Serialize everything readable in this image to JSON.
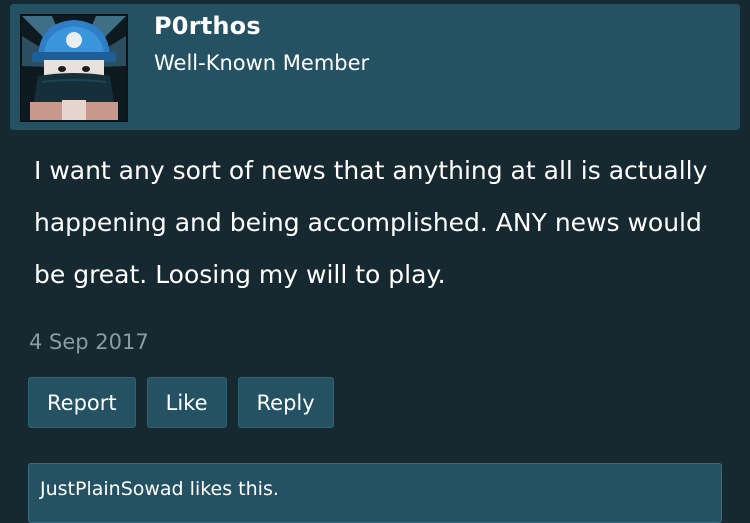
{
  "post": {
    "username": "P0rthos",
    "user_title": "Well-Known Member",
    "message": "I want any sort of news that anything at all is actually happening and being accomplished. ANY news would be great. Loosing my will to play.",
    "date": "4 Sep 2017"
  },
  "actions": {
    "report_label": "Report",
    "like_label": "Like",
    "reply_label": "Reply"
  },
  "likes": {
    "text": "JustPlainSowad likes this."
  },
  "colors": {
    "background": "#162830",
    "panel": "#245262",
    "muted_text": "#8a9ba2",
    "text": "#ffffff"
  }
}
